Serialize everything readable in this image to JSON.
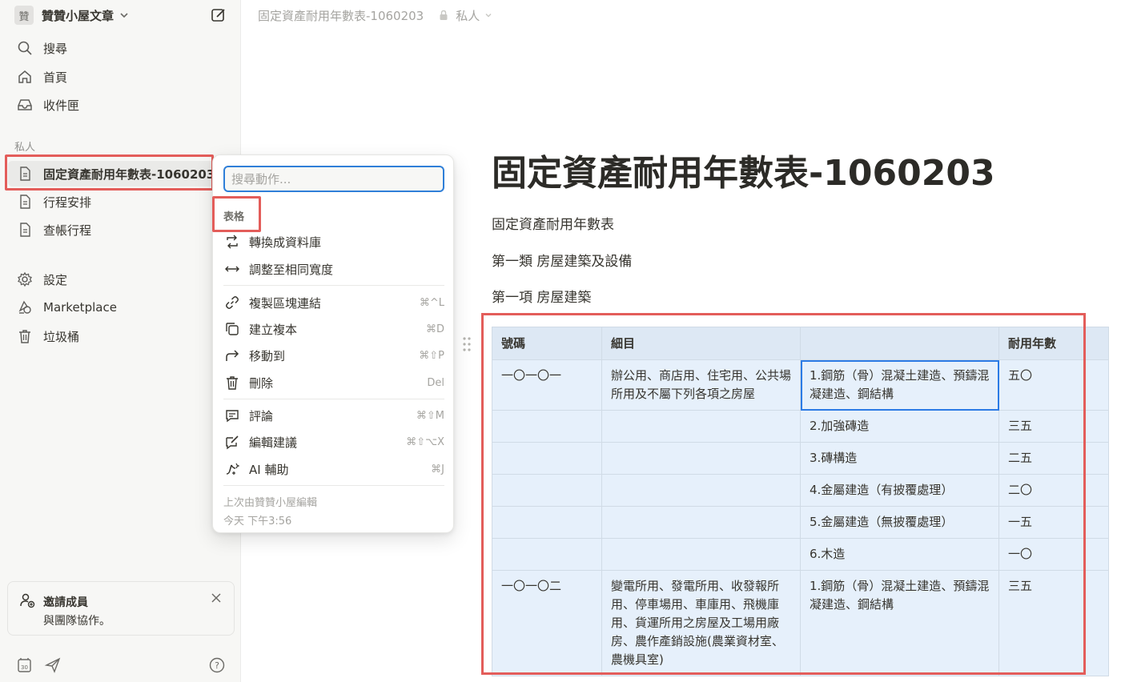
{
  "sidebar": {
    "workspace_initial": "贊",
    "workspace_name": "贊贊小屋文章",
    "nav": [
      {
        "label": "搜尋"
      },
      {
        "label": "首頁"
      },
      {
        "label": "收件匣"
      }
    ],
    "section_label": "私人",
    "pages": [
      {
        "label": "固定資產耐用年數表-1060203"
      },
      {
        "label": "行程安排"
      },
      {
        "label": "查帳行程"
      }
    ],
    "tools": [
      {
        "label": "設定"
      },
      {
        "label": "Marketplace"
      },
      {
        "label": "垃圾桶"
      }
    ],
    "invite": {
      "title": "邀請成員",
      "subtitle": "與團隊協作。"
    }
  },
  "breadcrumb": {
    "title": "固定資產耐用年數表-1060203",
    "privacy": "私人"
  },
  "page": {
    "title": "固定資產耐用年數表-1060203",
    "paragraphs": [
      "固定資產耐用年數表",
      "第一類 房屋建築及設備",
      "第一項 房屋建築"
    ]
  },
  "table": {
    "headers": [
      "號碼",
      "細目",
      "",
      "耐用年數"
    ],
    "rows": [
      [
        "一〇一〇一",
        "辦公用、商店用、住宅用、公共場所用及不屬下列各項之房屋",
        "1.鋼筋（骨）混凝土建造、預鑄混凝建造、鋼結構",
        "五〇"
      ],
      [
        "",
        "",
        "2.加強磚造",
        "三五"
      ],
      [
        "",
        "",
        "3.磚構造",
        "二五"
      ],
      [
        "",
        "",
        "4.金屬建造（有披覆處理）",
        "二〇"
      ],
      [
        "",
        "",
        "5.金屬建造（無披覆處理）",
        "一五"
      ],
      [
        "",
        "",
        "6.木造",
        "一〇"
      ],
      [
        "一〇一〇二",
        "變電所用、發電所用、收發報所用、停車場用、車庫用、飛機庫用、貨運所用之房屋及工場用廠房、農作產銷設施(農業資材室、農機具室)",
        "1.鋼筋（骨）混凝土建造、預鑄混凝建造、鋼結構",
        "三五"
      ]
    ]
  },
  "menu": {
    "search_placeholder": "搜尋動作...",
    "section": "表格",
    "items": [
      {
        "label": "轉換成資料庫",
        "shortcut": ""
      },
      {
        "label": "調整至相同寬度",
        "shortcut": ""
      },
      {
        "label": "複製區塊連結",
        "shortcut": "⌘^L"
      },
      {
        "label": "建立複本",
        "shortcut": "⌘D"
      },
      {
        "label": "移動到",
        "shortcut": "⌘⇧P"
      },
      {
        "label": "刪除",
        "shortcut": "Del"
      },
      {
        "label": "評論",
        "shortcut": "⌘⇧M"
      },
      {
        "label": "編輯建議",
        "shortcut": "⌘⇧⌥X"
      },
      {
        "label": "AI 輔助",
        "shortcut": "⌘J"
      }
    ],
    "footer_editor": "上次由贊贊小屋編輯",
    "footer_time": "今天 下午3:56"
  }
}
